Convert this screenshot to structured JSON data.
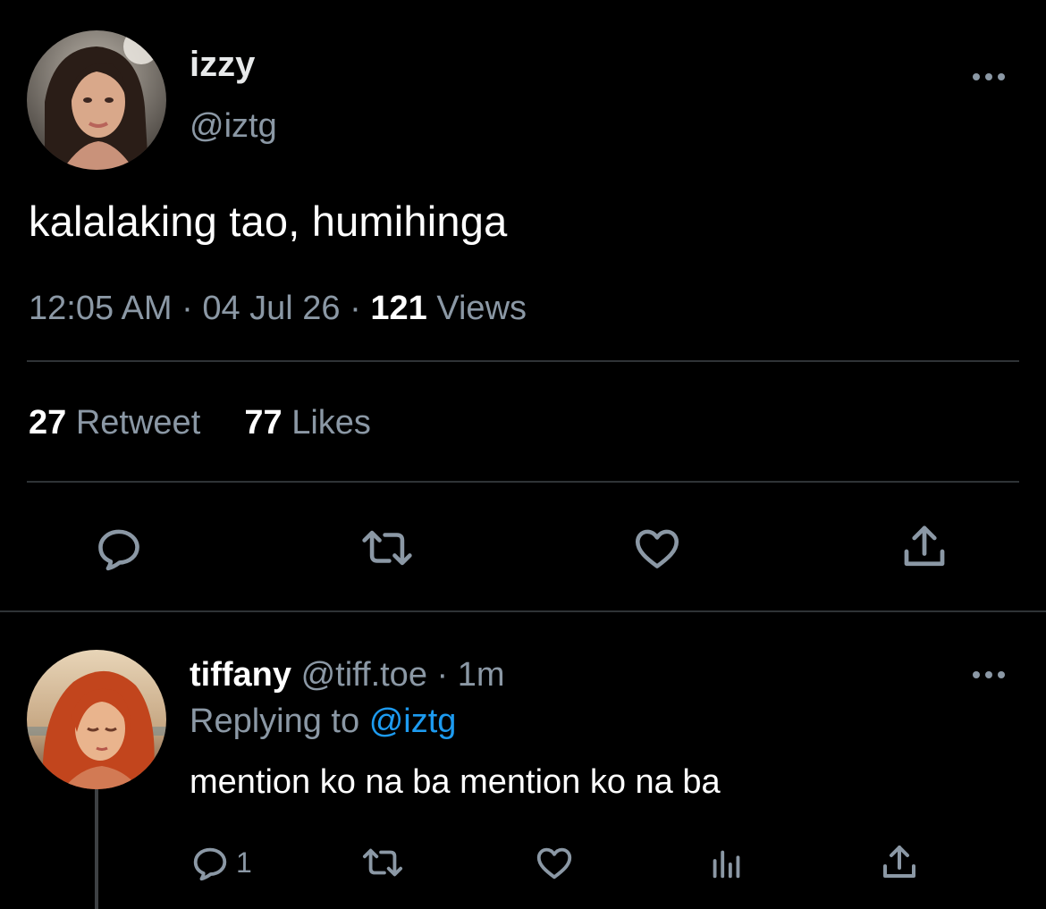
{
  "main_tweet": {
    "author_name": "izzy",
    "author_handle": "@iztg",
    "text": "kalalaking tao, humihinga",
    "time": "12:05 AM",
    "date": "04 Jul 26",
    "views_count": "121",
    "views_label": "Views",
    "retweet_count": "27",
    "retweet_label": "Retweet",
    "likes_count": "77",
    "likes_label": "Likes",
    "separator": "·",
    "actions": {
      "reply_icon": "reply-icon",
      "retweet_icon": "retweet-icon",
      "like_icon": "heart-icon",
      "share_icon": "share-icon"
    }
  },
  "reply": {
    "author_name": "tiffany",
    "author_handle": "@tiff.toe",
    "separator": "·",
    "time_ago": "1m",
    "replying_to_label": "Replying to",
    "replying_to_handle": "@iztg",
    "text": "mention ko na ba mention ko na ba",
    "reply_count": "1",
    "actions": {
      "reply_icon": "reply-icon",
      "retweet_icon": "retweet-icon",
      "like_icon": "heart-icon",
      "analytics_icon": "analytics-icon",
      "share_icon": "share-icon"
    }
  },
  "colors": {
    "background": "#000000",
    "primary_text": "#e7e9ea",
    "secondary_text": "#8b98a5",
    "link": "#1d9bf0",
    "divider": "#2f3336"
  }
}
